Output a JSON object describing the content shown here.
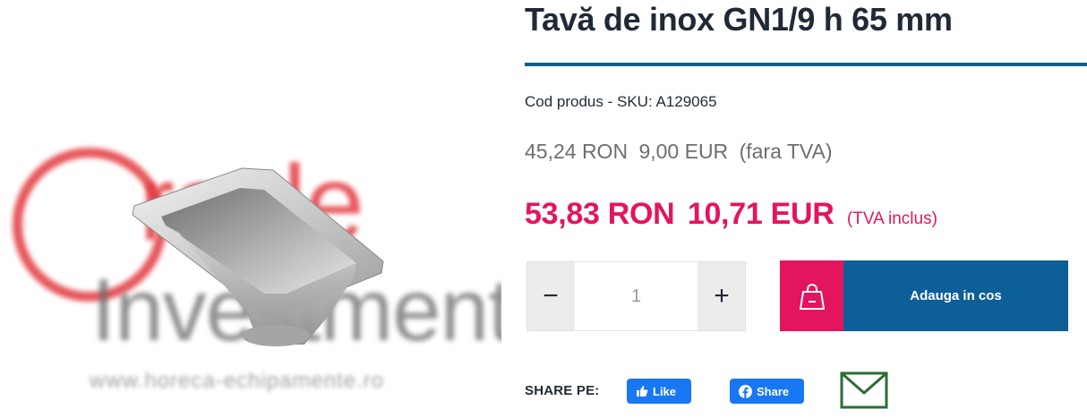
{
  "product": {
    "title": "Tavă de inox GN1/9 h 65 mm",
    "sku_text": "Cod produs - SKU: A129065",
    "image_alt": "Tava de inox GN1/9"
  },
  "watermark": {
    "line1_first": "O",
    "line1_rest": "racle",
    "line2": "Investment",
    "url": "www.horeca-echipamente.ro"
  },
  "price_net": {
    "ron": "45,24 RON",
    "eur": "9,00 EUR",
    "note": "(fara TVA)"
  },
  "price_gross": {
    "ron": "53,83 RON",
    "eur": "10,71 EUR",
    "note": "(TVA inclus)"
  },
  "quantity": {
    "minus_label": "−",
    "plus_label": "+",
    "value": "1"
  },
  "cart": {
    "label": "Adauga in cos",
    "icon": "shopping-bag-icon"
  },
  "share": {
    "label": "SHARE PE:",
    "like_label": "Like",
    "share_label": "Share",
    "mail_icon": "envelope-icon"
  },
  "colors": {
    "accent_red": "#e3155f",
    "brand_blue": "#0d5f98",
    "facebook_blue": "#1877f2",
    "mail_green": "#2e6b35"
  }
}
